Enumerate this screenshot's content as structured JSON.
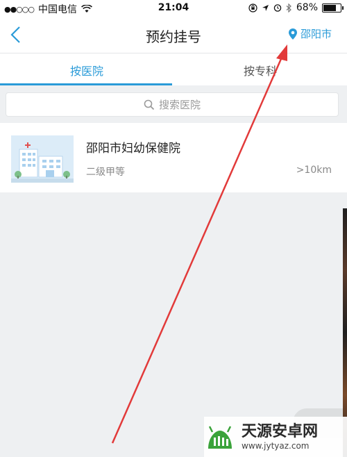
{
  "status_bar": {
    "carrier": "中国电信",
    "time": "21:04",
    "battery": "68%",
    "battery_level": 0.68
  },
  "nav": {
    "title": "预约挂号",
    "city": "邵阳市",
    "icons": [
      "back-chevron-icon",
      "location-pin-icon"
    ]
  },
  "tabs": [
    {
      "label": "按医院",
      "active": true
    },
    {
      "label": "按专科",
      "active": false
    }
  ],
  "search": {
    "placeholder": "搜索医院"
  },
  "hospitals": [
    {
      "name": "邵阳市妇幼保健院",
      "level": "二级甲等",
      "distance": ">10km"
    }
  ],
  "watermark": {
    "title": "天源安卓网",
    "url": "www.jytyaz.com"
  },
  "colors": {
    "accent": "#2a9bd8",
    "arrow": "#e23a3a",
    "background": "#eef0f2"
  }
}
